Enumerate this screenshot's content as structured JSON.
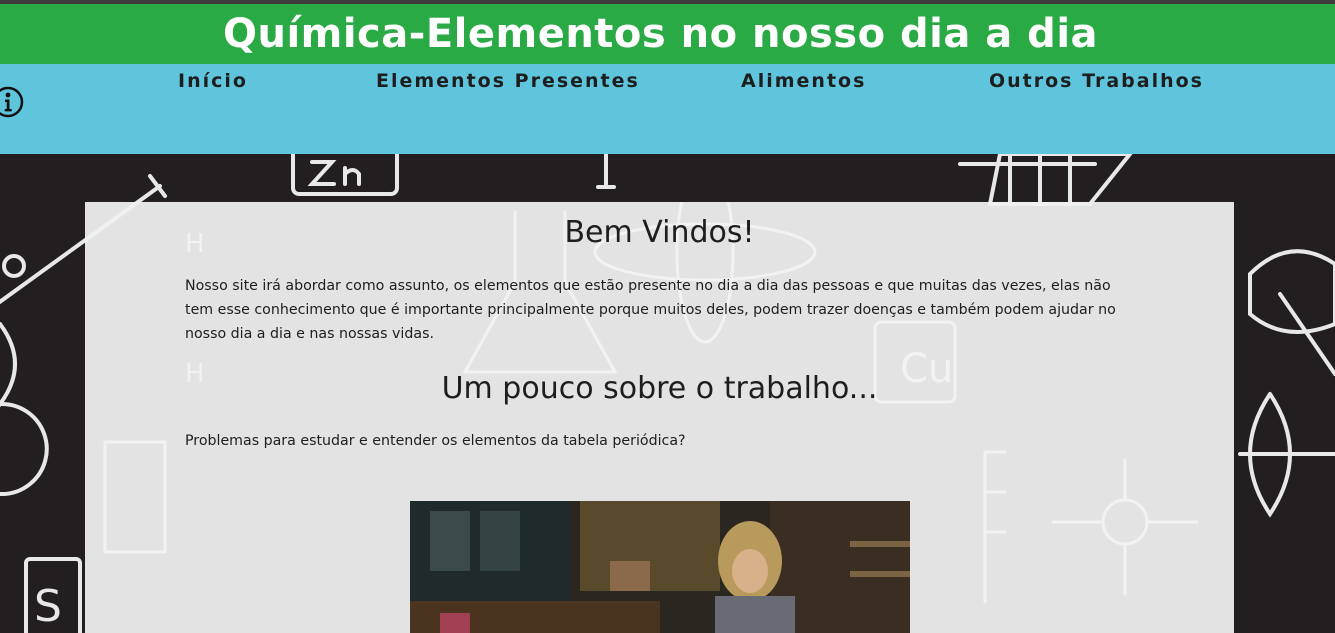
{
  "site": {
    "title": "Química-Elementos no nosso dia a dia"
  },
  "nav": {
    "items": [
      {
        "label": "Início"
      },
      {
        "label": "Elementos Presentes"
      },
      {
        "label": "Alimentos"
      },
      {
        "label": "Outros Trabalhos"
      }
    ]
  },
  "main": {
    "welcome_heading": "Bem Vindos!",
    "intro_text": "Nosso site irá abordar como assunto, os elementos que estão presente no dia a dia das pessoas e que muitas das vezes, elas não tem esse conhecimento que é importante principalmente porque muitos deles, podem trazer doenças e também podem ajudar no nosso dia a dia e nas nossas vidas.",
    "about_heading": "Um pouco sobre o trabalho...",
    "question_text": "Problemas para estudar e entender os elementos da tabela periódica?"
  },
  "icons": {
    "info": "info-circle-icon"
  },
  "colors": {
    "title_bar": "#2aaa45",
    "nav_bar": "#5fc5dd",
    "background": "#231f20",
    "panel": "#f0f0f0"
  }
}
